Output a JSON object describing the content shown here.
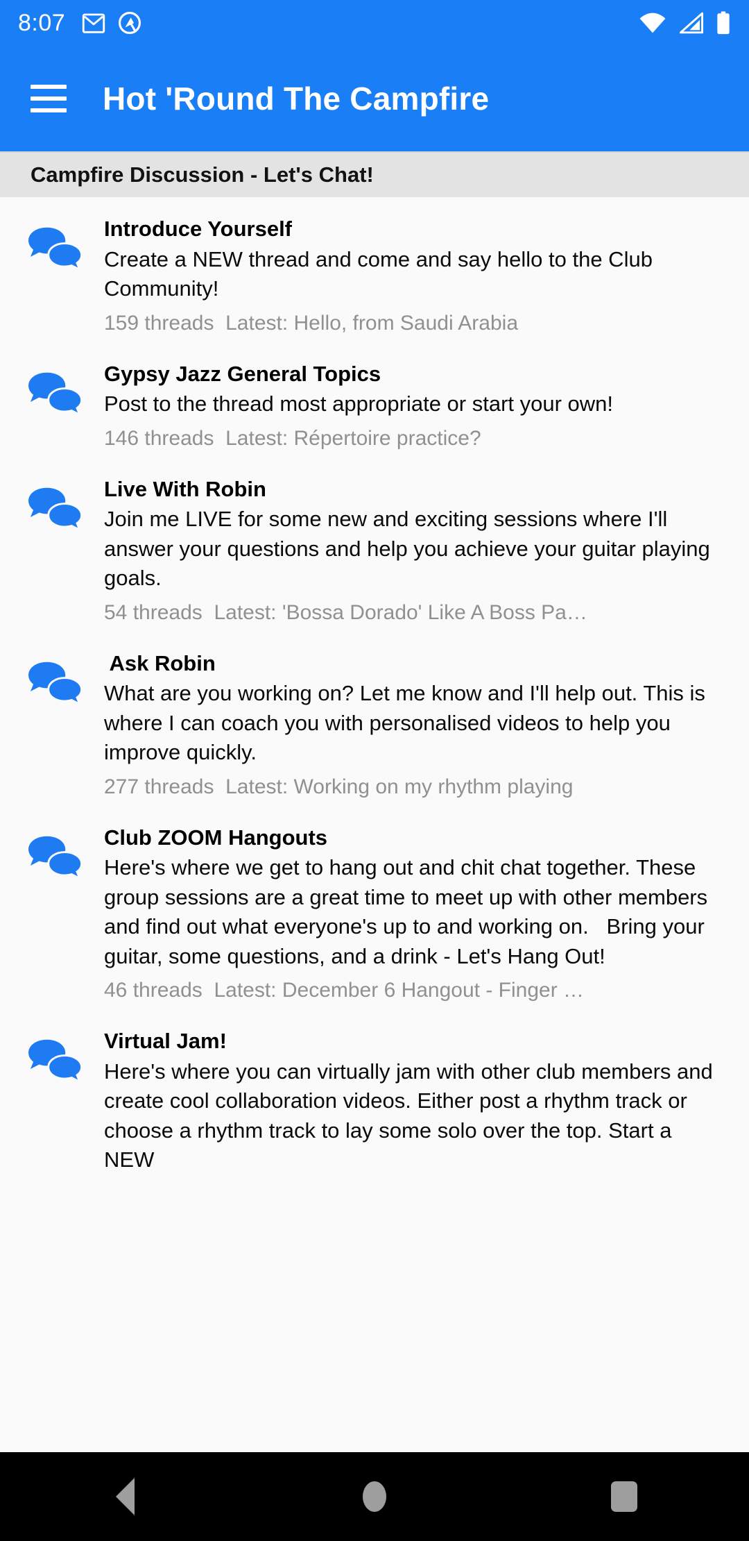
{
  "status_bar": {
    "clock": "8:07",
    "left_icons": [
      "gmail-icon",
      "app-notification-icon"
    ],
    "right_icons": [
      "wifi-icon",
      "cell-signal-off-icon",
      "battery-full-icon"
    ]
  },
  "app_bar": {
    "menu_icon": "hamburger-menu-icon",
    "title": "Hot 'Round The Campfire",
    "background_color": "#1a7ef7",
    "text_color": "#ffffff"
  },
  "section": {
    "header": "Campfire Discussion - Let's Chat!",
    "background_color": "#e3e3e3"
  },
  "forums": [
    {
      "icon": "chat-bubbles-icon",
      "title": "Introduce Yourself",
      "description": "Create a NEW thread and come and say hello to the Club Community!",
      "threads": "159 threads",
      "latest": "Latest: Hello, from Saudi Arabia"
    },
    {
      "icon": "chat-bubbles-icon",
      "title": "Gypsy Jazz General Topics",
      "description": "Post to the thread most appropriate or start your own!",
      "threads": "146 threads",
      "latest": "Latest: Répertoire practice?"
    },
    {
      "icon": "chat-bubbles-icon",
      "title": "Live With Robin",
      "description": "Join me LIVE for some new and exciting sessions where I'll answer your questions and help you achieve your guitar playing goals.",
      "threads": "54 threads",
      "latest": "Latest: 'Bossa Dorado' Like A Boss Pa…"
    },
    {
      "icon": "chat-bubbles-icon",
      "title": " Ask Robin",
      "description": "What are you working on? Let me know and I'll help out. This is where I can coach you with personalised videos to help you improve quickly.",
      "threads": "277 threads",
      "latest": "Latest: Working on my rhythm playing"
    },
    {
      "icon": "chat-bubbles-icon",
      "title": "Club ZOOM Hangouts",
      "description": "Here's where we get to hang out and chit chat together. These group sessions are a great time to meet up with other members and find out what everyone's up to and working on.   Bring your guitar, some questions, and a drink - Let's Hang Out!",
      "threads": "46 threads",
      "latest": "Latest: December 6 Hangout - Finger …"
    },
    {
      "icon": "chat-bubbles-icon",
      "title": "Virtual Jam!",
      "description": "Here's where you can virtually jam with other club members and create cool collaboration videos. Either post a rhythm track or choose a rhythm track to lay some solo over the top. Start a NEW",
      "threads": "",
      "latest": ""
    }
  ],
  "nav_bar": {
    "back_label": "back-button",
    "home_label": "home-button",
    "recents_label": "recents-button",
    "background_color": "#000000"
  },
  "colors": {
    "accent": "#1a7ef7",
    "icon_blue": "#1f7bf2",
    "page_background": "#fafafa",
    "meta_text": "#909090"
  }
}
